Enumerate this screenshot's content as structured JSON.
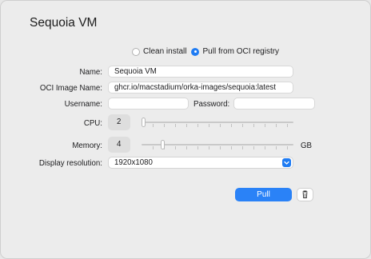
{
  "window": {
    "title": "Sequoia VM"
  },
  "source": {
    "option_clean": "Clean install",
    "option_oci": "Pull from OCI registry",
    "selected": "Pull from OCI registry"
  },
  "form": {
    "name_label": "Name:",
    "name_value": "Sequoia VM",
    "oci_label": "OCI Image Name:",
    "oci_value": "ghcr.io/macstadium/orka-images/sequoia:latest",
    "username_label": "Username:",
    "username_value": "",
    "password_label": "Password:",
    "password_value": "",
    "cpu_label": "CPU:",
    "cpu_value": "2",
    "memory_label": "Memory:",
    "memory_value": "4",
    "memory_unit": "GB",
    "display_label": "Display resolution:",
    "display_value": "1920x1080"
  },
  "actions": {
    "pull_label": "Pull",
    "delete_icon": "trash-icon"
  }
}
